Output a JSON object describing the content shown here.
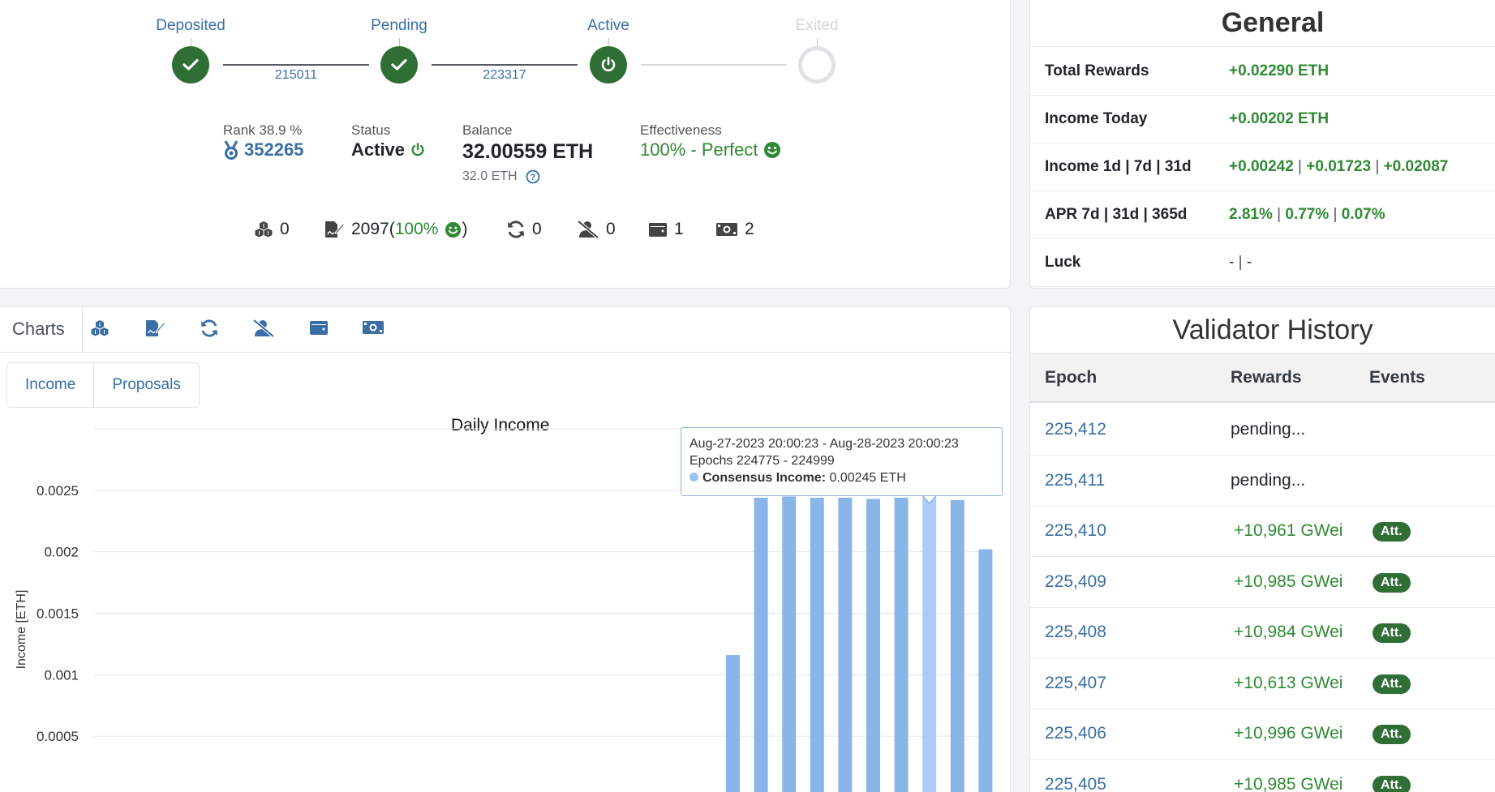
{
  "progress": {
    "steps": [
      {
        "label": "Deposited"
      },
      {
        "label": "Pending"
      },
      {
        "label": "Active"
      },
      {
        "label": "Exited"
      }
    ],
    "epochs": [
      "215011",
      "223317"
    ]
  },
  "stats": {
    "rank_label": "Rank 38.9 %",
    "rank_value": "352265",
    "status_label": "Status",
    "status_value": "Active",
    "balance_label": "Balance",
    "balance_value": "32.00559 ETH",
    "balance_sub": "32.0 ETH",
    "effectiveness_label": "Effectiveness",
    "effectiveness_value": "100% - Perfect"
  },
  "counters": {
    "blocks": "0",
    "attestations": "2097",
    "attestations_pct": "100%",
    "sync": "0",
    "slashings": "0",
    "deposits": "1",
    "withdrawals": "2"
  },
  "charts": {
    "title": "Charts",
    "subtabs": [
      "Income",
      "Proposals"
    ],
    "tooltip": {
      "range": "Aug-27-2023 20:00:23 - Aug-28-2023 20:00:23",
      "epochs": "Epochs 224775 - 224999",
      "series_label": "Consensus Income:",
      "series_value": "0.00245 ETH"
    }
  },
  "chart_data": {
    "type": "bar",
    "title": "Daily Income",
    "ylabel": "Income [ETH]",
    "ylim": [
      0,
      0.003
    ],
    "yticks": [
      "0",
      "0.0005",
      "0.001",
      "0.0015",
      "0.002",
      "0.0025"
    ],
    "series": [
      {
        "name": "Consensus Income",
        "values": [
          0.00116,
          0.00244,
          0.00245,
          0.00244,
          0.00244,
          0.00243,
          0.00244,
          0.00245,
          0.00242,
          0.00202
        ]
      }
    ],
    "highlight_index": 7,
    "colors": {
      "bar": "#8ab5e8",
      "highlight": "#a9cdf5",
      "grid": "#e6e6e6"
    }
  },
  "general": {
    "title": "General",
    "rows": [
      {
        "key": "Total Rewards",
        "values": [
          "+0.02290 ETH"
        ]
      },
      {
        "key": "Income Today",
        "values": [
          "+0.00202 ETH"
        ]
      },
      {
        "key": "Income 1d | 7d | 31d",
        "values": [
          "+0.00242",
          "+0.01723",
          "+0.02087"
        ]
      },
      {
        "key": "APR 7d | 31d | 365d",
        "values": [
          "2.81%",
          "0.77%",
          "0.07%"
        ]
      },
      {
        "key": "Luck",
        "values": [
          "-",
          "-"
        ]
      }
    ]
  },
  "history": {
    "title": "Validator History",
    "columns": [
      "Epoch",
      "Rewards",
      "Events"
    ],
    "rows": [
      {
        "epoch": "225,412",
        "rewards": "pending...",
        "event": ""
      },
      {
        "epoch": "225,411",
        "rewards": "pending...",
        "event": ""
      },
      {
        "epoch": "225,410",
        "rewards": "+10,961 GWei",
        "event": "Att."
      },
      {
        "epoch": "225,409",
        "rewards": "+10,985 GWei",
        "event": "Att."
      },
      {
        "epoch": "225,408",
        "rewards": "+10,984 GWei",
        "event": "Att."
      },
      {
        "epoch": "225,407",
        "rewards": "+10,613 GWei",
        "event": "Att."
      },
      {
        "epoch": "225,406",
        "rewards": "+10,996 GWei",
        "event": "Att."
      },
      {
        "epoch": "225,405",
        "rewards": "+10,985 GWei",
        "event": "Att."
      }
    ]
  }
}
